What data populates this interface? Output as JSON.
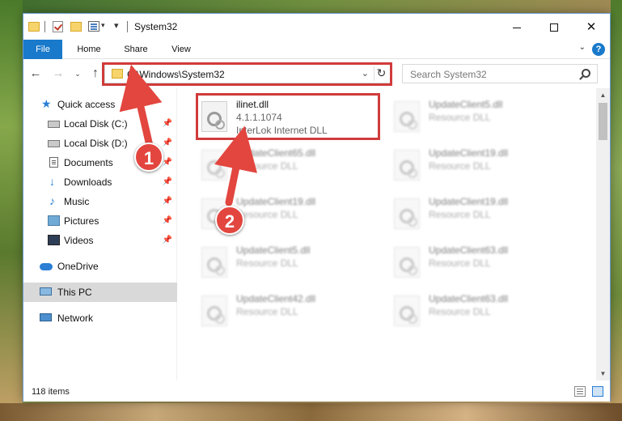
{
  "window": {
    "title": "System32",
    "minimize_icon": "minimize-icon",
    "maximize_icon": "maximize-icon",
    "close_glyph": "✕"
  },
  "ribbon": {
    "tabs": [
      {
        "label": "File"
      },
      {
        "label": "Home"
      },
      {
        "label": "Share"
      },
      {
        "label": "View"
      }
    ],
    "help_glyph": "?",
    "collapse_glyph": "⌄"
  },
  "nav": {
    "back_glyph": "←",
    "forward_glyph": "→",
    "recent_glyph": "⌄",
    "up_glyph": "↑"
  },
  "address": {
    "path": "C:\\Windows\\System32",
    "dropdown_glyph": "⌄",
    "refresh_glyph": "↻"
  },
  "search": {
    "placeholder": "Search System32"
  },
  "sidebar": {
    "items": [
      {
        "label": "Quick access",
        "icon": "star-icon"
      },
      {
        "label": "Local Disk (C:)",
        "icon": "disk-icon",
        "pinned": true
      },
      {
        "label": "Local Disk (D:)",
        "icon": "disk-icon",
        "pinned": true
      },
      {
        "label": "Documents",
        "icon": "document-icon",
        "pinned": true
      },
      {
        "label": "Downloads",
        "icon": "download-icon",
        "pinned": true
      },
      {
        "label": "Music",
        "icon": "music-icon",
        "pinned": true
      },
      {
        "label": "Pictures",
        "icon": "pictures-icon",
        "pinned": true
      },
      {
        "label": "Videos",
        "icon": "video-icon",
        "pinned": true
      },
      {
        "label": "OneDrive",
        "icon": "cloud-icon"
      },
      {
        "label": "This PC",
        "icon": "computer-icon",
        "selected": true
      },
      {
        "label": "Network",
        "icon": "network-icon"
      }
    ],
    "pin_glyph": "📌"
  },
  "files": [
    {
      "name": "ilinet.dll",
      "version": "4.1.1.1074",
      "description": "InterLok Internet DLL",
      "highlighted": true
    },
    {
      "name": "UpdateClient5.dll",
      "description": "Resource DLL"
    },
    {
      "name": "UpdateClient65.dll",
      "description": "Resource DLL"
    },
    {
      "name": "UpdateClient19.dll",
      "description": "Resource DLL"
    },
    {
      "name": "UpdateClient19.dll",
      "description": "Resource DLL"
    },
    {
      "name": "UpdateClient19.dll",
      "description": "Resource DLL"
    },
    {
      "name": "UpdateClient5.dll",
      "description": "Resource DLL"
    },
    {
      "name": "UpdateClient63.dll",
      "description": "Resource DLL"
    },
    {
      "name": "UpdateClient42.dll",
      "description": "Resource DLL"
    },
    {
      "name": "UpdateClient63.dll",
      "description": "Resource DLL"
    }
  ],
  "status": {
    "item_count": "118 items"
  },
  "callouts": [
    {
      "label": "1"
    },
    {
      "label": "2"
    }
  ],
  "colors": {
    "accent": "#1979ca",
    "highlight": "#d03b3b",
    "callout": "#e2463f"
  }
}
